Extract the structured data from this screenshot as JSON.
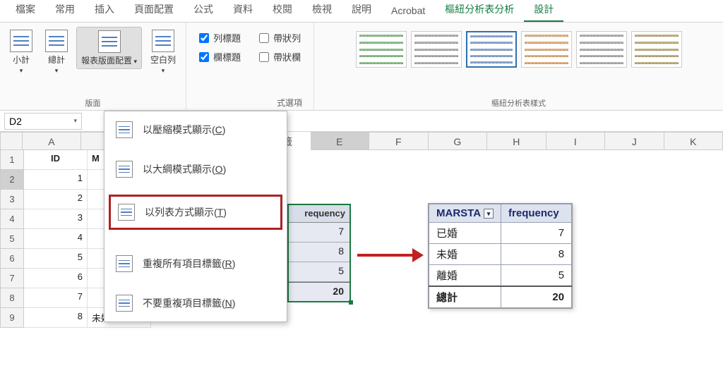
{
  "tabs": [
    "檔案",
    "常用",
    "插入",
    "頁面配置",
    "公式",
    "資料",
    "校閱",
    "檢視",
    "說明",
    "Acrobat",
    "樞紐分析表分析",
    "設計"
  ],
  "active_tab_index": 11,
  "ribbon": {
    "layout": {
      "subtotal": "小計",
      "grandtotal": "總計",
      "report_layout": "報表版面配置",
      "blank_rows": "空白列",
      "group_label": "版面"
    },
    "options": {
      "row_header": "列標題",
      "col_header": "欄標題",
      "banded_rows": "帶狀列",
      "banded_cols": "帶狀欄",
      "row_header_checked": true,
      "col_header_checked": true,
      "banded_rows_checked": false,
      "banded_cols_checked": false,
      "group_label_suffix": "式選項"
    },
    "styles_label": "樞紐分析表樣式"
  },
  "namebox": "D2",
  "fx_suffix": "籤",
  "menu": {
    "compressed": "以壓縮模式顯示(C)",
    "outline": "以大綱模式顯示(O)",
    "tabular": "以列表方式顯示(T)",
    "repeat_labels": "重複所有項目標籤(R)",
    "no_repeat": "不要重複項目標籤(N)",
    "compressed_u": "C",
    "outline_u": "O",
    "tabular_u": "T",
    "repeat_u": "R",
    "norepeat_u": "N"
  },
  "cols": [
    "A",
    "B",
    "C",
    "D",
    "E",
    "F",
    "G",
    "H",
    "I",
    "J",
    "K"
  ],
  "rows": [
    "1",
    "2",
    "3",
    "4",
    "5",
    "6",
    "7",
    "8",
    "9"
  ],
  "sheet": {
    "A1": "ID",
    "B1_prefix": "M",
    "A2": "1",
    "A3": "2",
    "A4": "3",
    "A5": "4",
    "A6": "5",
    "A7": "6",
    "A8": "7",
    "A9": "8",
    "B9": "未婚"
  },
  "pivot1": {
    "header": "requency",
    "v1": "7",
    "v2": "8",
    "v3": "5",
    "total": "20"
  },
  "pivot2": {
    "col1": "MARSTA",
    "col2": "frequency",
    "r1": "已婚",
    "v1": "7",
    "r2": "未婚",
    "v2": "8",
    "r3": "離婚",
    "v3": "5",
    "rt": "總計",
    "vt": "20"
  }
}
